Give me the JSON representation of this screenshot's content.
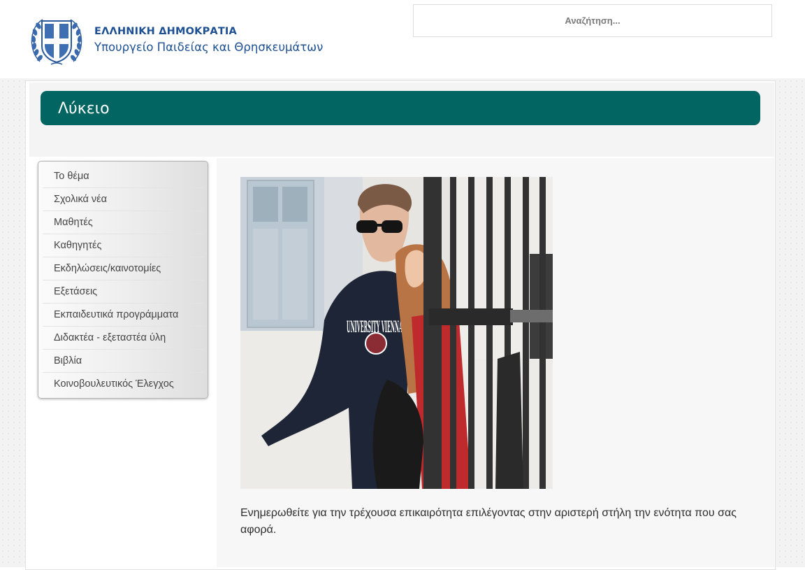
{
  "header": {
    "ministry_line1": "ΕΛΛΗΝΙΚΗ ΔΗΜΟΚΡΑΤΙΑ",
    "ministry_line2": "Υπουργείο Παιδείας και Θρησκευμάτων",
    "logo_icon": "greek-coat-of-arms-icon",
    "search_placeholder": "Αναζήτηση..."
  },
  "page": {
    "title": "Λύκειο",
    "title_bar_color": "#036562"
  },
  "sidebar": {
    "items": [
      {
        "label": "Το θέμα"
      },
      {
        "label": "Σχολικά νέα"
      },
      {
        "label": "Μαθητές"
      },
      {
        "label": "Καθηγητές"
      },
      {
        "label": "Εκδηλώσεις/καινοτομίες"
      },
      {
        "label": "Εξετάσεις"
      },
      {
        "label": "Εκπαιδευτικά προγράμματα"
      },
      {
        "label": "Διδακτέα - εξεταστέα ύλη"
      },
      {
        "label": "Βιβλία"
      },
      {
        "label": "Κοινοβουλευτικός Έλεγχος"
      }
    ]
  },
  "content": {
    "photo_sweatshirt_text": "UNIVERSITY VIENNA",
    "intro_text": "Ενημερωθείτε για την τρέχουσα επικαιρότητα επιλέγοντας στην αριστερή στήλη την ενότητα που σας αφορά."
  }
}
